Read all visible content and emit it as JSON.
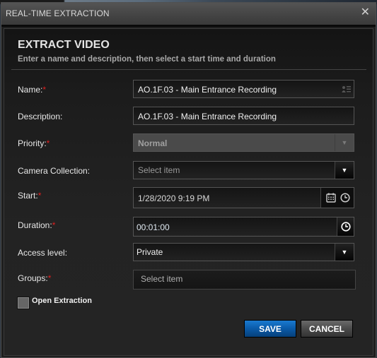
{
  "window": {
    "title": "REAL-TIME EXTRACTION",
    "close_icon": "close-icon"
  },
  "header": {
    "title": "EXTRACT VIDEO",
    "subtitle": "Enter a name and description, then select a start time and duration"
  },
  "form": {
    "required_marker": "*",
    "name": {
      "label": "Name:",
      "required": true,
      "value": "AO.1F.03 - Main Entrance Recording",
      "icon": "contact-card-icon"
    },
    "description": {
      "label": "Description:",
      "required": false,
      "value": "AO.1F.03 - Main Entrance Recording"
    },
    "priority": {
      "label": "Priority:",
      "required": true,
      "value": "Normal",
      "disabled": true
    },
    "camera_collection": {
      "label": "Camera Collection:",
      "required": false,
      "placeholder": "Select item"
    },
    "start": {
      "label": "Start:",
      "required": true,
      "value": "1/28/2020 9:19 PM",
      "icons": [
        "calendar-icon",
        "clock-icon"
      ]
    },
    "duration": {
      "label": "Duration:",
      "required": true,
      "value": "00:01:00",
      "icon": "clock-icon"
    },
    "access_level": {
      "label": "Access level:",
      "required": false,
      "value": "Private"
    },
    "groups": {
      "label": "Groups:",
      "required": true,
      "placeholder": "Select item"
    },
    "open_extraction": {
      "label": "Open Extraction",
      "checked": false
    }
  },
  "buttons": {
    "save": "SAVE",
    "cancel": "CANCEL"
  },
  "colors": {
    "accent": "#0a5aa8",
    "required": "#e02020"
  }
}
